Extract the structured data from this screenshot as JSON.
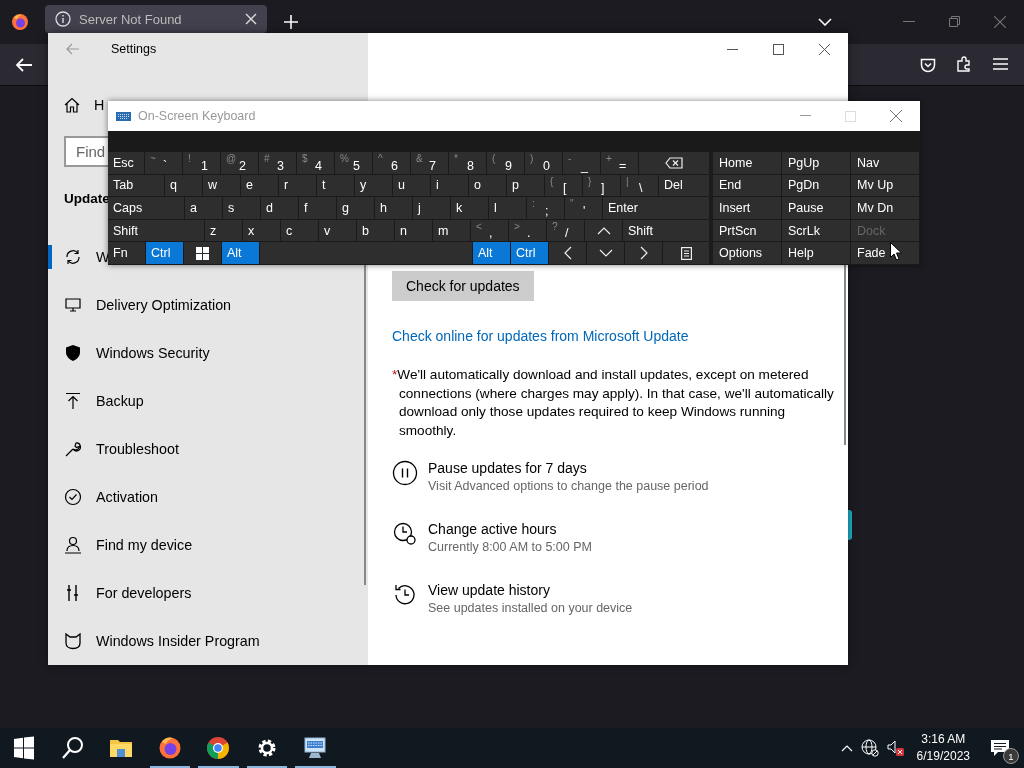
{
  "browser": {
    "tab": {
      "title": "Server Not Found",
      "selected": true
    }
  },
  "settings": {
    "title": "Settings",
    "nav": {
      "home": "H",
      "search_placeholder": "Find",
      "section": "Update",
      "items": [
        {
          "kind": "sync",
          "label": "W",
          "selected": true
        },
        {
          "kind": "delivery",
          "label": "Delivery Optimization",
          "selected": false
        },
        {
          "kind": "shield",
          "label": "Windows Security",
          "selected": false
        },
        {
          "kind": "backup",
          "label": "Backup",
          "selected": false
        },
        {
          "kind": "wrench",
          "label": "Troubleshoot",
          "selected": false
        },
        {
          "kind": "check",
          "label": "Activation",
          "selected": false
        },
        {
          "kind": "person",
          "label": "Find my device",
          "selected": false
        },
        {
          "kind": "tools",
          "label": "For developers",
          "selected": false
        },
        {
          "kind": "insider",
          "label": "Windows Insider Program",
          "selected": false
        }
      ]
    },
    "content": {
      "check_button": "Check for updates",
      "online_link": "Check online for updates from Microsoft Update",
      "note_mark": "*",
      "note": "We'll automatically download and install updates, except on metered connections (where charges may apply). In that case, we'll automatically download only those updates required to keep Windows running smoothly.",
      "options": [
        {
          "kind": "pause",
          "title": "Pause updates for 7 days",
          "subtitle": "Visit Advanced options to change the pause period"
        },
        {
          "kind": "hours",
          "title": "Change active hours",
          "subtitle": "Currently 8:00 AM to 5:00 PM"
        },
        {
          "kind": "history",
          "title": "View update history",
          "subtitle": "See updates installed on your device"
        }
      ]
    }
  },
  "keyboard": {
    "title": "On-Screen Keyboard",
    "main_rows": [
      [
        {
          "kind": "text",
          "label": "Esc",
          "pressed": false
        },
        {
          "kind": "dual",
          "shift": "~",
          "label": "`",
          "pressed": false
        },
        {
          "kind": "dual",
          "shift": "!",
          "label": "1",
          "pressed": false
        },
        {
          "kind": "dual",
          "shift": "@",
          "label": "2",
          "pressed": false
        },
        {
          "kind": "dual",
          "shift": "#",
          "label": "3",
          "pressed": false
        },
        {
          "kind": "dual",
          "shift": "$",
          "label": "4",
          "pressed": false
        },
        {
          "kind": "dual",
          "shift": "%",
          "label": "5",
          "pressed": false
        },
        {
          "kind": "dual",
          "shift": "^",
          "label": "6",
          "pressed": false
        },
        {
          "kind": "dual",
          "shift": "&",
          "label": "7",
          "pressed": false
        },
        {
          "kind": "dual",
          "shift": "*",
          "label": "8",
          "pressed": false
        },
        {
          "kind": "dual",
          "shift": "(",
          "label": "9",
          "pressed": false
        },
        {
          "kind": "dual",
          "shift": ")",
          "label": "0",
          "pressed": false
        },
        {
          "kind": "dual",
          "shift": "-",
          "label": "_",
          "pressed": false
        },
        {
          "kind": "dual",
          "shift": "+",
          "label": "=",
          "pressed": false
        },
        {
          "kind": "backspace",
          "pressed": false
        }
      ],
      [
        {
          "kind": "text",
          "label": "Tab",
          "pressed": false
        },
        {
          "kind": "text",
          "label": "q",
          "pressed": false
        },
        {
          "kind": "text",
          "label": "w",
          "pressed": false
        },
        {
          "kind": "text",
          "label": "e",
          "pressed": false
        },
        {
          "kind": "text",
          "label": "r",
          "pressed": false
        },
        {
          "kind": "text",
          "label": "t",
          "pressed": false
        },
        {
          "kind": "text",
          "label": "y",
          "pressed": false
        },
        {
          "kind": "text",
          "label": "u",
          "pressed": false
        },
        {
          "kind": "text",
          "label": "i",
          "pressed": false
        },
        {
          "kind": "text",
          "label": "o",
          "pressed": false
        },
        {
          "kind": "text",
          "label": "p",
          "pressed": false
        },
        {
          "kind": "dual",
          "shift": "{",
          "label": "[",
          "pressed": false
        },
        {
          "kind": "dual",
          "shift": "}",
          "label": "]",
          "pressed": false
        },
        {
          "kind": "dual",
          "shift": "|",
          "label": "\\",
          "pressed": false
        },
        {
          "kind": "text",
          "label": "Del",
          "pressed": false
        }
      ],
      [
        {
          "kind": "text",
          "label": "Caps",
          "pressed": false
        },
        {
          "kind": "text",
          "label": "a",
          "pressed": false
        },
        {
          "kind": "text",
          "label": "s",
          "pressed": false
        },
        {
          "kind": "text",
          "label": "d",
          "pressed": false
        },
        {
          "kind": "text",
          "label": "f",
          "pressed": false
        },
        {
          "kind": "text",
          "label": "g",
          "pressed": false
        },
        {
          "kind": "text",
          "label": "h",
          "pressed": false
        },
        {
          "kind": "text",
          "label": "j",
          "pressed": false
        },
        {
          "kind": "text",
          "label": "k",
          "pressed": false
        },
        {
          "kind": "text",
          "label": "l",
          "pressed": false
        },
        {
          "kind": "dual",
          "shift": ":",
          "label": ";",
          "pressed": false
        },
        {
          "kind": "dual",
          "shift": "\"",
          "label": "'",
          "pressed": false
        },
        {
          "kind": "text",
          "label": "Enter",
          "pressed": false
        }
      ],
      [
        {
          "kind": "text",
          "label": "Shift",
          "pressed": false
        },
        {
          "kind": "text",
          "label": "z",
          "pressed": false
        },
        {
          "kind": "text",
          "label": "x",
          "pressed": false
        },
        {
          "kind": "text",
          "label": "c",
          "pressed": false
        },
        {
          "kind": "text",
          "label": "v",
          "pressed": false
        },
        {
          "kind": "text",
          "label": "b",
          "pressed": false
        },
        {
          "kind": "text",
          "label": "n",
          "pressed": false
        },
        {
          "kind": "text",
          "label": "m",
          "pressed": false
        },
        {
          "kind": "dual",
          "shift": "<",
          "label": ",",
          "pressed": false
        },
        {
          "kind": "dual",
          "shift": ">",
          "label": ".",
          "pressed": false
        },
        {
          "kind": "dual",
          "shift": "?",
          "label": "/",
          "pressed": false
        },
        {
          "kind": "up",
          "pressed": false
        },
        {
          "kind": "text",
          "label": "Shift",
          "pressed": false
        }
      ],
      [
        {
          "kind": "text",
          "label": "Fn",
          "pressed": false
        },
        {
          "kind": "text",
          "label": "Ctrl",
          "pressed": true
        },
        {
          "kind": "windows",
          "pressed": false
        },
        {
          "kind": "text",
          "label": "Alt",
          "pressed": true
        },
        {
          "kind": "space",
          "pressed": false
        },
        {
          "kind": "text",
          "label": "Alt",
          "pressed": true
        },
        {
          "kind": "text",
          "label": "Ctrl",
          "pressed": true
        },
        {
          "kind": "left",
          "pressed": false
        },
        {
          "kind": "down",
          "pressed": false
        },
        {
          "kind": "right",
          "pressed": false
        },
        {
          "kind": "menu",
          "pressed": false
        }
      ]
    ],
    "side_rows": [
      [
        {
          "label": "Home",
          "disabled": false
        },
        {
          "label": "PgUp",
          "disabled": false
        },
        {
          "label": "Nav",
          "disabled": false
        }
      ],
      [
        {
          "label": "End",
          "disabled": false
        },
        {
          "label": "PgDn",
          "disabled": false
        },
        {
          "label": "Mv Up",
          "disabled": false
        }
      ],
      [
        {
          "label": "Insert",
          "disabled": false
        },
        {
          "label": "Pause",
          "disabled": false
        },
        {
          "label": "Mv Dn",
          "disabled": false
        }
      ],
      [
        {
          "label": "PrtScn",
          "disabled": false
        },
        {
          "label": "ScrLk",
          "disabled": false
        },
        {
          "label": "Dock",
          "disabled": true
        }
      ],
      [
        {
          "label": "Options",
          "disabled": false
        },
        {
          "label": "Help",
          "disabled": false
        },
        {
          "label": "Fade",
          "disabled": false
        }
      ]
    ]
  },
  "taskbar": {
    "apps": [
      {
        "kind": "start",
        "open": false
      },
      {
        "kind": "search",
        "open": false
      },
      {
        "kind": "folder",
        "open": false
      },
      {
        "kind": "firefox",
        "open": true
      },
      {
        "kind": "chrome",
        "open": true
      },
      {
        "kind": "gear",
        "open": true
      },
      {
        "kind": "keyboard",
        "open": true
      }
    ],
    "time": "3:16 AM",
    "date": "6/19/2023",
    "notifications": "1"
  }
}
